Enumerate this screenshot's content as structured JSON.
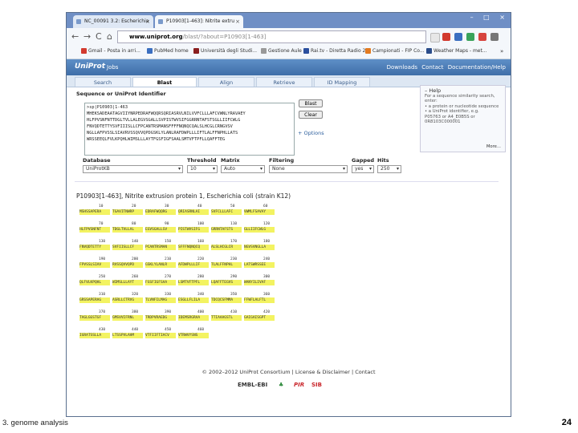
{
  "browser": {
    "tabs": [
      {
        "label": "NC_00091 3.2: Escherichia"
      },
      {
        "label": "P10903[1-463]: Nitrite extru"
      }
    ],
    "window_controls": "– □ ×",
    "address": {
      "host": "www.uniprot.org",
      "path": "/blast/?about=P10903[1-463]"
    },
    "bookmarks": [
      {
        "label": "Gmail - Posta in arri..."
      },
      {
        "label": "PubMed home"
      },
      {
        "label": "Università degli Studi..."
      },
      {
        "label": "Gestione Aule"
      },
      {
        "label": "Rai.tv - Diretta Radio 2"
      },
      {
        "label": "Campionati - FIP Co..."
      },
      {
        "label": "Weather Maps - met..."
      }
    ]
  },
  "uniprot": {
    "logo": "UniProt",
    "jobs": "Jobs",
    "header_links": "Downloads  Contact  Documentation/Help",
    "tabs": [
      "Search",
      "Blast",
      "Align",
      "Retrieve",
      "ID Mapping"
    ],
    "active_tab": "Blast",
    "seq_label": "Sequence or UniProt Identifier",
    "sequence_text": ">sp|P10903|1-463\nMHEKSADEAATAGVIIYNRPEDRAFWQQRSQRIASRVLNILVVFCLLLAFCVWNLYRAVAEY\nHLFPVSNFNTTDGLTVLLALEGVSGALLSVPISTWVSIFGGRRNTAFSTSGLLIIFCWLG\nFNVQDTETTYSVFIIISLLCFPCANTRSMANSFFFFNQNQCQALSLHCGLCRNGVSV\nNGLLAFPVSSLSIAVRVSSQVVQPDGSKLYLANLRAFDWPLLLIFTLALFFNPHLLATS\nWRSSEEQLFVLKPQHLWIMSLLLAYTFGSFIGFSAALSMTVFTPFLLQAFFTEG",
    "blast_button": "Blast",
    "clear_button": "Clear",
    "options_link": "+ Options",
    "help": {
      "title": "– Help",
      "lines": [
        "For a sequence similarity search, enter:",
        "• a protein or nucleotide sequence",
        "• a UniProt identifier, e.g.",
        "  P05763 or A4_E0B5S or 0R8103C000001"
      ],
      "more": "More..."
    },
    "fields": {
      "database": {
        "label": "Database",
        "value": "UniProtKB"
      },
      "threshold": {
        "label": "Threshold",
        "value": "10"
      },
      "matrix": {
        "label": "Matrix",
        "value": "Auto"
      },
      "filtering": {
        "label": "Filtering",
        "value": "None"
      },
      "gapped": {
        "label": "Gapped",
        "value": "yes"
      },
      "hits": {
        "label": "Hits",
        "value": "250"
      }
    },
    "protein_title": "P10903[1-463], Nitrite extrusion protein 1, Escherichia coli (strain K12)",
    "sequence_rows": [
      {
        "nums": [
          "10",
          "20",
          "30",
          "40",
          "50",
          "60"
        ],
        "chunks": [
          "MSHSSAPERA",
          "TGAVITNWRP",
          "EDRAFWQQRG",
          "QRIASRNLAI",
          "SVFCLLLAFC",
          "VWMLFSAVAY"
        ]
      },
      {
        "nums": [
          "70",
          "80",
          "90",
          "100",
          "110",
          "120"
        ],
        "chunks": [
          "HLFPVSNFNT",
          "TDGLTVLLAL",
          "EGVSGALLSV",
          "PISTWVSIFG",
          "GRRNTAFSTS",
          "GLLIIFCWLG"
        ]
      },
      {
        "nums": [
          "130",
          "140",
          "150",
          "160",
          "170",
          "180"
        ],
        "chunks": [
          "FNVQDTETTY",
          "SVFIISLLCF",
          "PCANTRSMAN",
          "SFFFNQNQCQ",
          "ALSLHCGLCR",
          "NGVSVNGLLA"
        ]
      },
      {
        "nums": [
          "190",
          "200",
          "210",
          "220",
          "230",
          "240"
        ],
        "chunks": [
          "FPVSSLSIAV",
          "RVSSQVVQPD",
          "GSKLYLANLR",
          "AFDWPLLLIF",
          "TLALFFNPHL",
          "LATSWRSSEE"
        ]
      },
      {
        "nums": [
          "250",
          "260",
          "270",
          "280",
          "290",
          "300"
        ],
        "chunks": [
          "QLFVLKPQHL",
          "WIMSLLLAYT",
          "FGSFIGFSAA",
          "LSMTVFTPFL",
          "LQAFFTEGVS",
          "WANYILIVAF"
        ]
      },
      {
        "nums": [
          "310",
          "320",
          "330",
          "340",
          "350",
          "360"
        ],
        "chunks": [
          "GRSSAPERAG",
          "ASRLLCTRVG",
          "TLVNFILMAG",
          "ESGLLFLILA",
          "TDCQCSFMMA",
          "FFWFLALFTL"
        ]
      },
      {
        "nums": [
          "370",
          "380",
          "390",
          "400",
          "410",
          "420"
        ],
        "chunks": [
          "TAGLGGSTGF",
          "GMSVVIFRNL",
          "TRDPVRAEDG",
          "IDEMSRGRAA",
          "TTIAAAGSTL",
          "GAIGAISGPT"
        ]
      },
      {
        "nums": [
          "430",
          "440",
          "450",
          "460"
        ],
        "chunks": [
          "IGRATSSLLA",
          "LTSSPVLAHM",
          "VTFIIFTIACV",
          "VTRWVYSNS"
        ]
      }
    ],
    "footer": "© 2002–2012 UniProt Consortium  |  License & Disclaimer  |  Contact",
    "footer_logos": [
      "EMBL-EBI",
      "PIR",
      "SIB"
    ]
  },
  "slide": {
    "caption": "3. genome analysis",
    "page_number": "24"
  }
}
